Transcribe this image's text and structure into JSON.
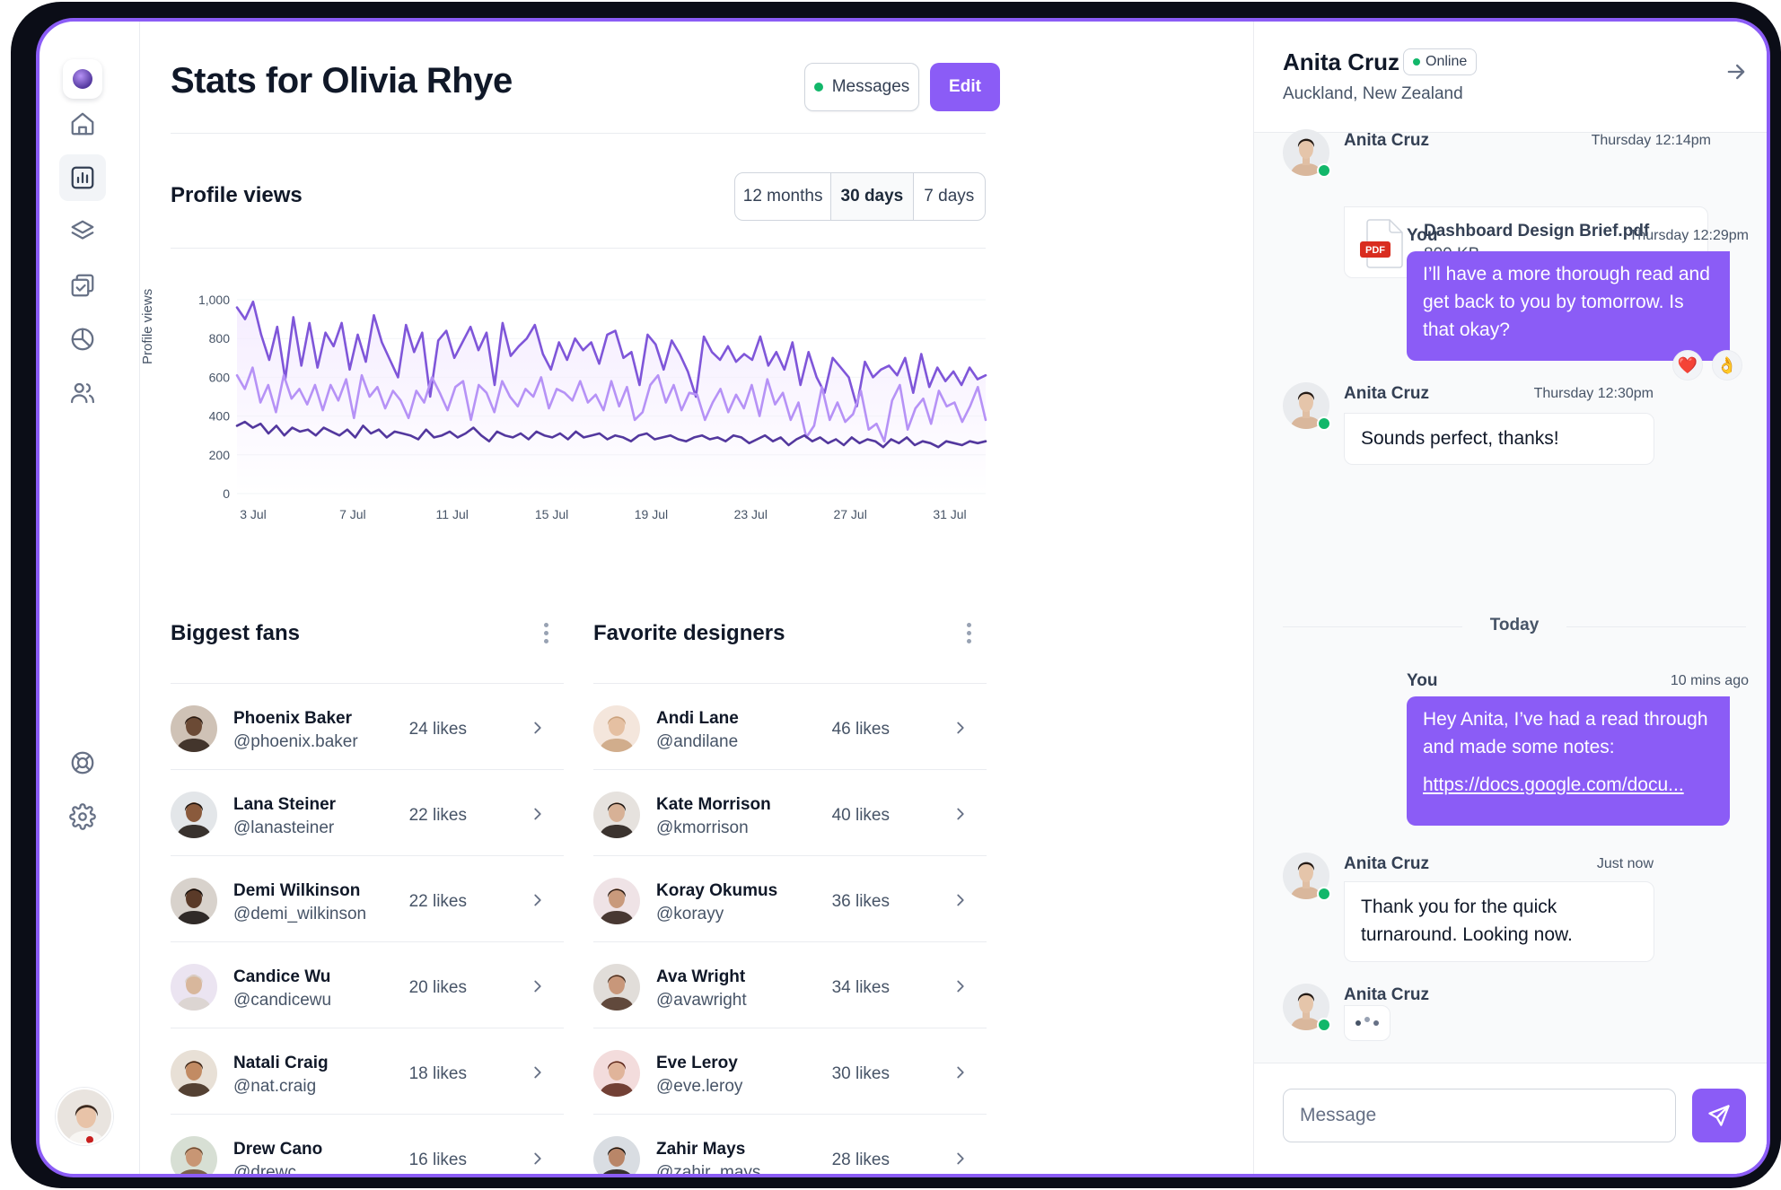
{
  "page": {
    "title": "Stats for Olivia Rhye"
  },
  "header": {
    "messages_label": "Messages",
    "edit_label": "Edit"
  },
  "sidebar": {
    "items": [
      {
        "icon": "home-icon"
      },
      {
        "icon": "bar-chart-icon",
        "active": true
      },
      {
        "icon": "layers-icon"
      },
      {
        "icon": "check-square-icon"
      },
      {
        "icon": "pie-chart-icon"
      },
      {
        "icon": "users-icon"
      },
      {
        "icon": "life-buoy-icon"
      },
      {
        "icon": "settings-icon"
      }
    ]
  },
  "profile_views": {
    "title": "Profile views",
    "ranges": [
      "12 months",
      "30 days",
      "7 days"
    ],
    "selected_range": "30 days"
  },
  "chart_data": {
    "type": "line",
    "ylabel": "Profile views",
    "ylim": [
      0,
      1000
    ],
    "yticks": [
      "1,000",
      "800",
      "600",
      "400",
      "200",
      "0"
    ],
    "xticks": [
      "3 Jul",
      "7 Jul",
      "11 Jul",
      "15 Jul",
      "19 Jul",
      "23 Jul",
      "27 Jul",
      "31 Jul"
    ],
    "grid": true,
    "series": [
      {
        "color": "#7f56d9",
        "fill": true,
        "values": [
          960,
          900,
          990,
          820,
          690,
          860,
          590,
          910,
          660,
          880,
          650,
          830,
          760,
          880,
          640,
          820,
          680,
          920,
          780,
          690,
          600,
          870,
          730,
          830,
          500,
          790,
          840,
          700,
          780,
          860,
          740,
          830,
          560,
          880,
          710,
          760,
          800,
          870,
          720,
          640,
          780,
          690,
          800,
          740,
          780,
          670,
          820,
          840,
          700,
          730,
          560,
          820,
          770,
          640,
          790,
          720,
          630,
          500,
          810,
          730,
          690,
          760,
          680,
          720,
          690,
          810,
          660,
          730,
          640,
          780,
          560,
          730,
          600,
          520,
          700,
          650,
          600,
          450,
          680,
          600,
          640,
          660,
          610,
          700,
          520,
          720,
          550,
          650,
          580,
          630,
          560,
          650,
          590,
          610
        ]
      },
      {
        "color": "#b692f6",
        "fill": false,
        "values": [
          610,
          540,
          650,
          470,
          560,
          420,
          610,
          490,
          540,
          460,
          560,
          430,
          560,
          480,
          590,
          390,
          610,
          500,
          550,
          440,
          530,
          480,
          390,
          530,
          470,
          600,
          520,
          430,
          550,
          580,
          380,
          560,
          520,
          420,
          580,
          500,
          450,
          540,
          500,
          600,
          440,
          540,
          520,
          480,
          580,
          470,
          510,
          430,
          580,
          450,
          550,
          380,
          420,
          560,
          610,
          470,
          560,
          430,
          520,
          510,
          380,
          470,
          540,
          420,
          510,
          440,
          560,
          400,
          590,
          460,
          520,
          380,
          470,
          290,
          350,
          550,
          380,
          470,
          370,
          410,
          530,
          330,
          360,
          270,
          480,
          560,
          330,
          440,
          490,
          360,
          530,
          450,
          470,
          370,
          450,
          550,
          380
        ]
      },
      {
        "color": "#53389e",
        "fill": false,
        "values": [
          350,
          370,
          340,
          360,
          310,
          350,
          300,
          340,
          320,
          330,
          300,
          340,
          320,
          300,
          330,
          290,
          350,
          310,
          330,
          290,
          320,
          310,
          300,
          280,
          330,
          290,
          300,
          320,
          290,
          310,
          340,
          300,
          270,
          320,
          300,
          290,
          310,
          280,
          320,
          300,
          290,
          310,
          280,
          320,
          290,
          300,
          310,
          280,
          300,
          290,
          270,
          300,
          310,
          280,
          290,
          300,
          280,
          270,
          290,
          300,
          280,
          290,
          270,
          300,
          290,
          260,
          280,
          300,
          270,
          290,
          250,
          280,
          300,
          270,
          290,
          260,
          280,
          250,
          290,
          260,
          280,
          270,
          240,
          280,
          260,
          290,
          250,
          270,
          260,
          240,
          270,
          260,
          250,
          270,
          260,
          270
        ]
      }
    ]
  },
  "fans": {
    "title": "Biggest fans",
    "rows": [
      {
        "name": "Phoenix Baker",
        "handle": "@phoenix.baker",
        "likes": "24 likes"
      },
      {
        "name": "Lana Steiner",
        "handle": "@lanasteiner",
        "likes": "22 likes"
      },
      {
        "name": "Demi Wilkinson",
        "handle": "@demi_wilkinson",
        "likes": "22 likes"
      },
      {
        "name": "Candice Wu",
        "handle": "@candicewu",
        "likes": "20 likes"
      },
      {
        "name": "Natali Craig",
        "handle": "@nat.craig",
        "likes": "18 likes"
      },
      {
        "name": "Drew Cano",
        "handle": "@drewc",
        "likes": "16 likes"
      }
    ]
  },
  "designers": {
    "title": "Favorite designers",
    "rows": [
      {
        "name": "Andi Lane",
        "handle": "@andilane",
        "likes": "46 likes"
      },
      {
        "name": "Kate Morrison",
        "handle": "@kmorrison",
        "likes": "40 likes"
      },
      {
        "name": "Koray Okumus",
        "handle": "@korayy",
        "likes": "36 likes"
      },
      {
        "name": "Ava Wright",
        "handle": "@avawright",
        "likes": "34 likes"
      },
      {
        "name": "Eve Leroy",
        "handle": "@eve.leroy",
        "likes": "30 likes"
      },
      {
        "name": "Zahir Mays",
        "handle": "@zahir_mays",
        "likes": "28 likes"
      }
    ]
  },
  "chat": {
    "name": "Anita Cruz",
    "status": "Online",
    "location": "Auckland, New Zealand",
    "messages": [
      {
        "sender": "Anita Cruz",
        "time": "Thursday 12:14pm",
        "file_name": "Dashboard Design Brief.pdf",
        "file_size": "800 KB",
        "file_badge": "PDF"
      },
      {
        "sender": "You",
        "time": "Thursday 12:29pm",
        "text": "I’ll have a more thorough read and get back to you by tomorrow. Is that okay?",
        "reactions": [
          "❤️",
          "👌"
        ]
      },
      {
        "sender": "Anita Cruz",
        "time": "Thursday 12:30pm",
        "text": "Sounds perfect, thanks!"
      },
      {
        "sender": "You",
        "time": "10 mins ago",
        "text": "Hey Anita, I’ve had a read through and made some notes:",
        "link": "https://docs.google.com/docu..."
      },
      {
        "sender": "Anita Cruz",
        "time": "Just now",
        "text": "Thank you for the quick turnaround. Looking now."
      },
      {
        "sender": "Anita Cruz",
        "typing": true
      }
    ],
    "today_label": "Today",
    "input_placeholder": "Message"
  }
}
